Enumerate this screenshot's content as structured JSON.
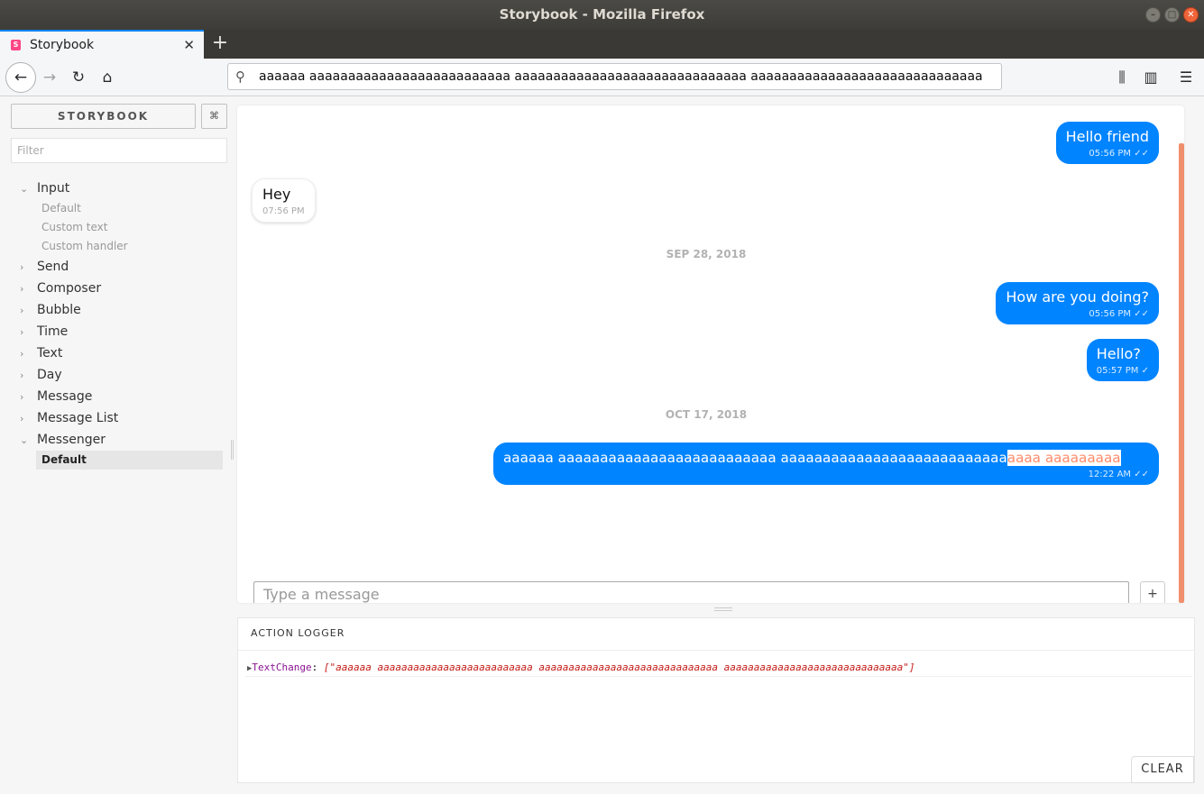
{
  "window": {
    "title": "Storybook - Mozilla Firefox"
  },
  "tab": {
    "title": "Storybook",
    "favicon": "S",
    "close": "✕"
  },
  "newtab": "+",
  "url": "aaaaaa aaaaaaaaaaaaaaaaaaaaaaaaaa aaaaaaaaaaaaaaaaaaaaaaaaaaaaaa aaaaaaaaaaaaaaaaaaaaaaaaaaaaaa",
  "sidebar": {
    "brand": "STORYBOOK",
    "shortcut": "⌘",
    "filter_placeholder": "Filter",
    "items": [
      {
        "label": "Input",
        "expanded": true,
        "children": [
          "Default",
          "Custom text",
          "Custom handler"
        ]
      },
      {
        "label": "Send"
      },
      {
        "label": "Composer"
      },
      {
        "label": "Bubble"
      },
      {
        "label": "Time"
      },
      {
        "label": "Text"
      },
      {
        "label": "Day"
      },
      {
        "label": "Message"
      },
      {
        "label": "Message List"
      },
      {
        "label": "Messenger",
        "expanded": true,
        "children": [
          "Default"
        ]
      }
    ]
  },
  "chat": {
    "messages": [
      {
        "text": "Hello friend",
        "time": "05:56 PM",
        "ticks": "✓✓"
      },
      {
        "text": "Hey",
        "time": "07:56 PM"
      },
      {
        "day": "SEP 28, 2018"
      },
      {
        "text": "How are you doing?",
        "time": "05:56 PM",
        "ticks": "✓✓"
      },
      {
        "text": "Hello?",
        "time": "05:57 PM",
        "ticks": "✓"
      },
      {
        "day": "OCT 17, 2018"
      },
      {
        "text_visible": "aaaaaa aaaaaaaaaaaaaaaaaaaaaaaaaa aaaaaaaaaaaaaaaaaaaaaaaaaaa",
        "text_overflow": "aaaa aaaaaaaaa",
        "time": "12:22 AM",
        "ticks": "✓✓"
      }
    ],
    "composer_placeholder": "Type a message",
    "plus": "+"
  },
  "action_logger": {
    "title": "ACTION LOGGER",
    "entry_key": "TextChange",
    "entry_value": "[\"aaaaaa aaaaaaaaaaaaaaaaaaaaaaaaaa aaaaaaaaaaaaaaaaaaaaaaaaaaaaaa aaaaaaaaaaaaaaaaaaaaaaaaaaaaaa\"]",
    "clear": "CLEAR"
  },
  "colors": {
    "bubble": "#0084ff",
    "accent": "#0a84ff",
    "overflow_text": "#ff8a6a",
    "scrollbar": "#f08f6c"
  }
}
